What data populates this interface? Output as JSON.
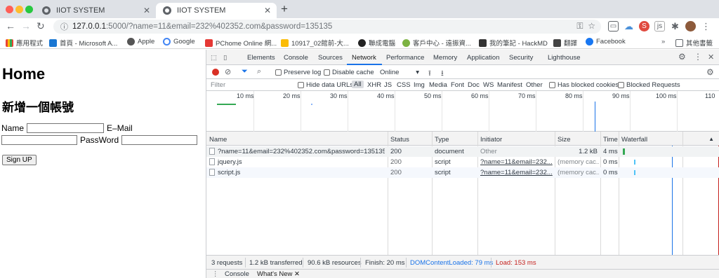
{
  "browser": {
    "tabs": [
      {
        "title": "IIOT SYSTEM",
        "active": false
      },
      {
        "title": "IIOT SYSTEM",
        "active": true
      }
    ],
    "url_host": "127.0.0.1",
    "url_rest": ":5000/?name=11&email=232%402352.com&password=135135",
    "bookmarks": [
      "應用程式",
      "首頁 - Microsoft A...",
      "Apple",
      "Google",
      "PChome Online 網...",
      "10917_02館前-大...",
      "聯成電腦",
      "客戶中心 - 遠振資...",
      "我的筆記 - HackMD",
      "翻譯",
      "Facebook"
    ],
    "other_bookmarks": "其他書籤",
    "ext_s": "S",
    "ext_js": "js"
  },
  "page": {
    "title": "Home",
    "subtitle": "新增一個帳號",
    "name_label": "Name",
    "email_label": "E–Mail",
    "password_label": "PassWord",
    "signup_label": "Sign UP"
  },
  "devtools": {
    "tabs": [
      "Elements",
      "Console",
      "Sources",
      "Network",
      "Performance",
      "Memory",
      "Application",
      "Security",
      "Lighthouse"
    ],
    "active_tab": "Network",
    "toolbar": {
      "preserve_log": "Preserve log",
      "disable_cache": "Disable cache",
      "throttle": "Online"
    },
    "filter": {
      "placeholder": "Filter",
      "hide_data_urls": "Hide data URLs",
      "types": [
        "All",
        "XHR",
        "JS",
        "CSS",
        "Img",
        "Media",
        "Font",
        "Doc",
        "WS",
        "Manifest",
        "Other"
      ],
      "has_blocked_cookies": "Has blocked cookies",
      "blocked_requests": "Blocked Requests"
    },
    "timeline_ticks": [
      "10 ms",
      "20 ms",
      "30 ms",
      "40 ms",
      "50 ms",
      "60 ms",
      "70 ms",
      "80 ms",
      "90 ms",
      "100 ms",
      "110"
    ],
    "columns": [
      "Name",
      "Status",
      "Type",
      "Initiator",
      "Size",
      "Time",
      "Waterfall"
    ],
    "requests": [
      {
        "name": "?name=11&email=232%402352.com&password=135135",
        "status": "200",
        "type": "document",
        "initiator": "Other",
        "size": "1.2 kB",
        "time": "4 ms"
      },
      {
        "name": "jquery.js",
        "status": "200",
        "type": "script",
        "initiator": "?name=11&email=232...",
        "size": "(memory cac...",
        "time": "0 ms"
      },
      {
        "name": "script.js",
        "status": "200",
        "type": "script",
        "initiator": "?name=11&email=232...",
        "size": "(memory cac...",
        "time": "0 ms"
      }
    ],
    "summary": {
      "requests": "3 requests",
      "transferred": "1.2 kB transferred",
      "resources": "90.6 kB resources",
      "finish": "Finish: 20 ms",
      "dcl": "DOMContentLoaded: 79 ms",
      "load": "Load: 153 ms"
    },
    "drawer_tabs": [
      "Console",
      "What's New"
    ]
  },
  "colors": {
    "accent": "#1a73e8",
    "record": "#d93025",
    "dcl": "#1a73e8",
    "load": "#c5221f"
  }
}
